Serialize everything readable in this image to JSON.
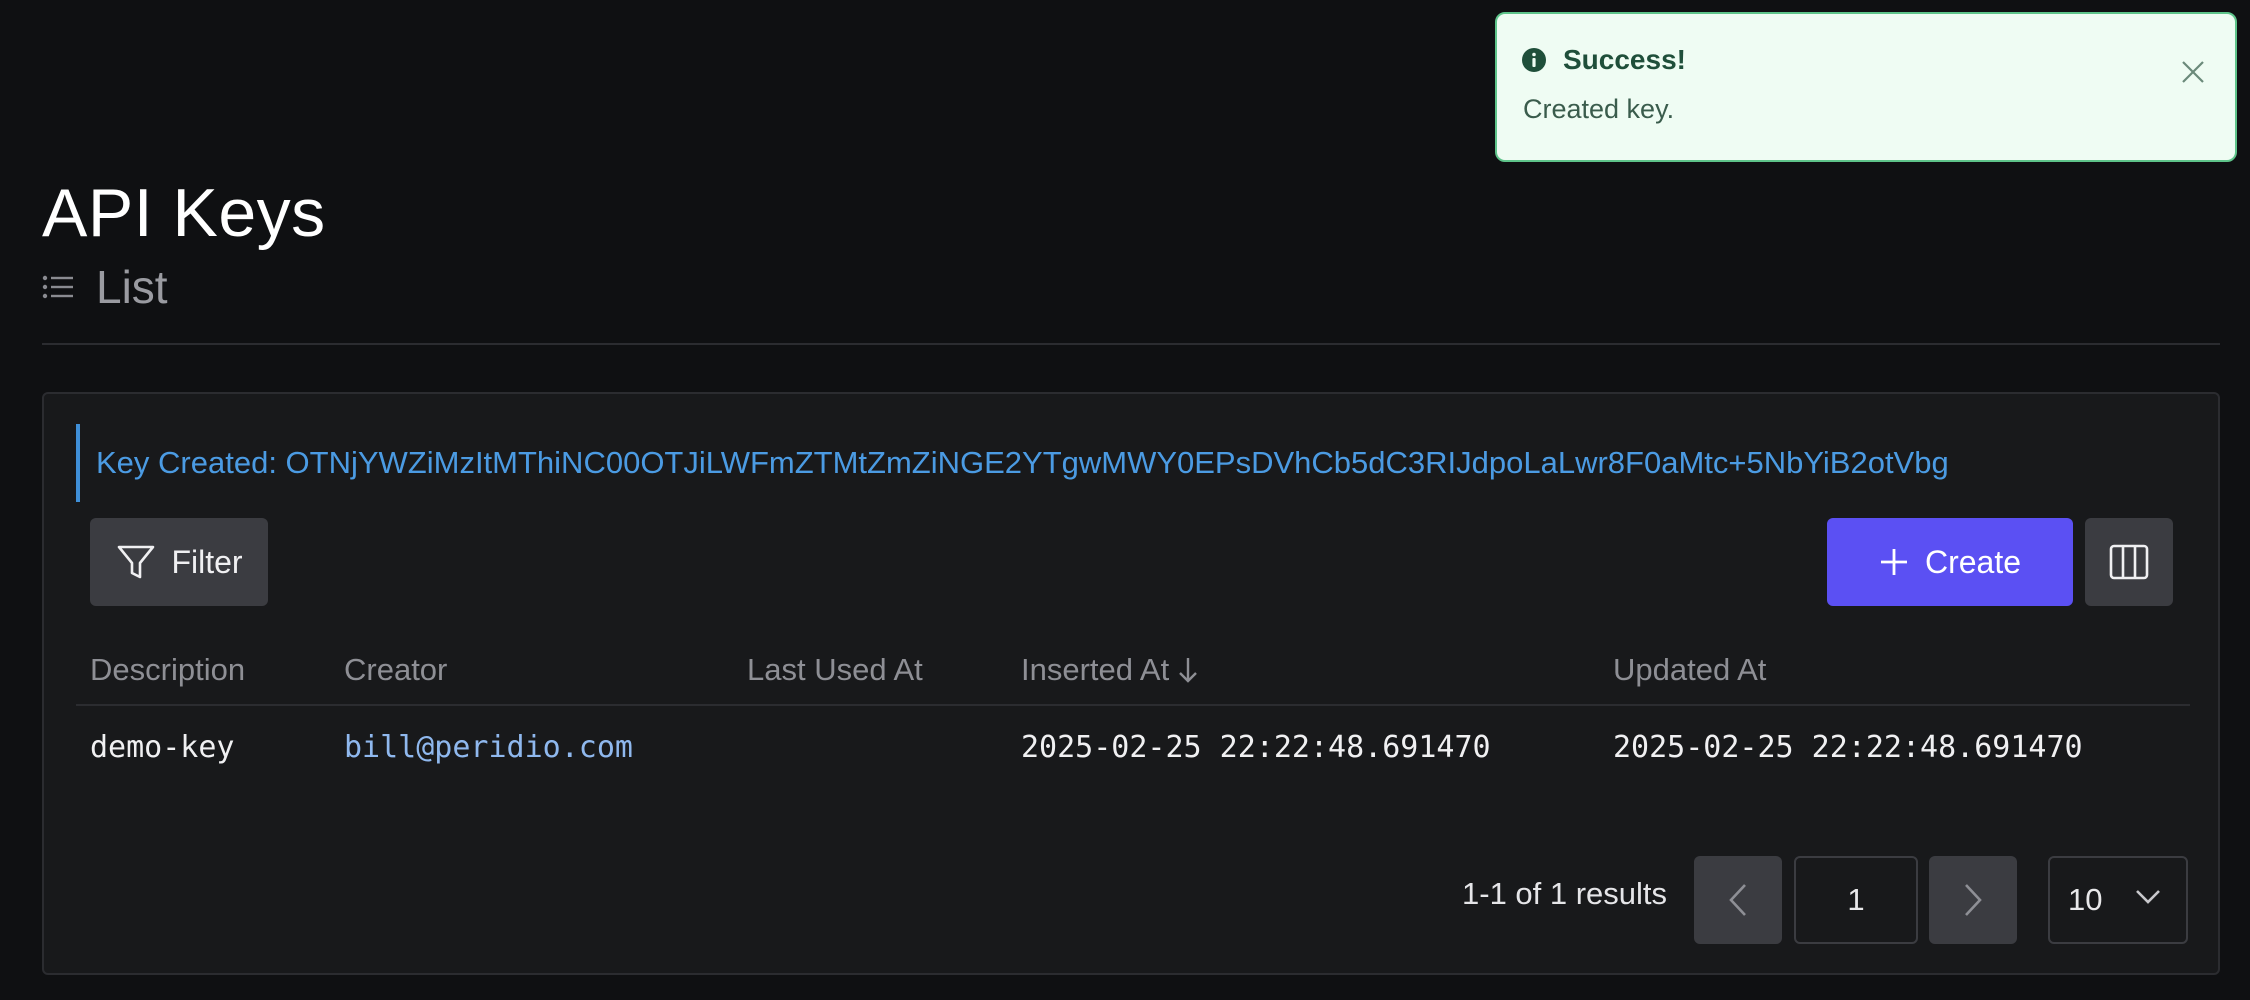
{
  "header": {
    "title": "API Keys",
    "subtitle": "List",
    "subtitle_icon": "list-icon"
  },
  "toast": {
    "icon": "info-icon",
    "title": "Success!",
    "message": "Created key.",
    "close_icon": "close-icon",
    "accent": "#5ec48a"
  },
  "banner": {
    "text": "Key Created: OTNjYWZiMzItMThiNC00OTJiLWFmZTMtZmZiNGE2YTgwMWY0EPsDVhCb5dC3RIJdpoLaLwr8F0aMtc+5NbYiB2otVbg"
  },
  "toolbar": {
    "filter_label": "Filter",
    "create_label": "Create",
    "columns_icon": "columns-icon",
    "accent": "#5b50f3"
  },
  "table": {
    "columns": [
      "Description",
      "Creator",
      "Last Used At",
      "Inserted At",
      "Updated At"
    ],
    "sort_column": "Inserted At",
    "sort_direction": "descending",
    "rows": [
      {
        "description": "demo-key",
        "creator": "bill@peridio.com",
        "last_used_at": "",
        "inserted_at": "2025-02-25 22:22:48.691470",
        "updated_at": "2025-02-25 22:22:48.691470"
      }
    ]
  },
  "pagination": {
    "results_text": "1-1 of 1 results",
    "current_page": "1",
    "page_size": "10"
  }
}
